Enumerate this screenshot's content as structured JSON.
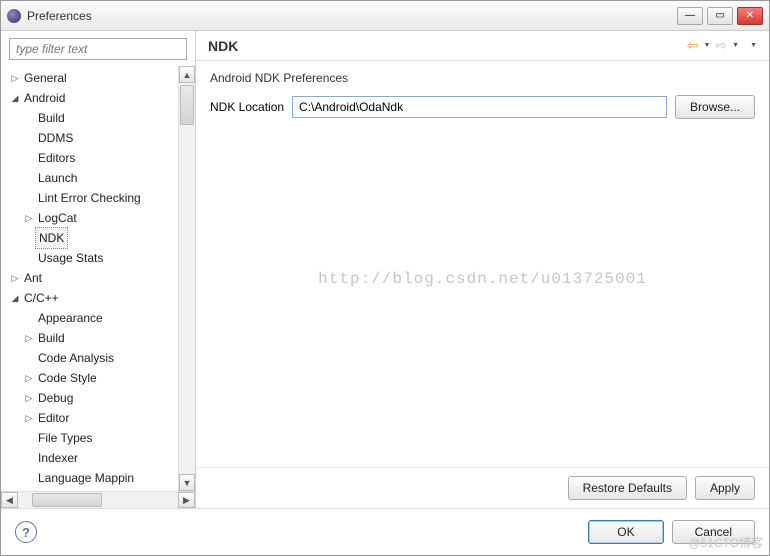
{
  "window": {
    "title": "Preferences"
  },
  "sidebar": {
    "filter_placeholder": "type filter text",
    "items": {
      "general": "General",
      "android": "Android",
      "build": "Build",
      "ddms": "DDMS",
      "editors": "Editors",
      "launch": "Launch",
      "lint": "Lint Error Checking",
      "logcat": "LogCat",
      "ndk": "NDK",
      "usage": "Usage Stats",
      "ant": "Ant",
      "ccpp": "C/C++",
      "appearance": "Appearance",
      "cbuild": "Build",
      "codeanalysis": "Code Analysis",
      "codestyle": "Code Style",
      "debug": "Debug",
      "ceditor": "Editor",
      "filetypes": "File Types",
      "indexer": "Indexer",
      "langmap": "Language Mappin"
    }
  },
  "main": {
    "title": "NDK",
    "section_title": "Android NDK Preferences",
    "ndk_label": "NDK Location",
    "ndk_value": "C:\\Android\\OdaNdk",
    "browse": "Browse...",
    "restore": "Restore Defaults",
    "apply": "Apply"
  },
  "bottom": {
    "ok": "OK",
    "cancel": "Cancel"
  },
  "watermark": "http://blog.csdn.net/u013725001",
  "watermark2": "@51CTO博客"
}
